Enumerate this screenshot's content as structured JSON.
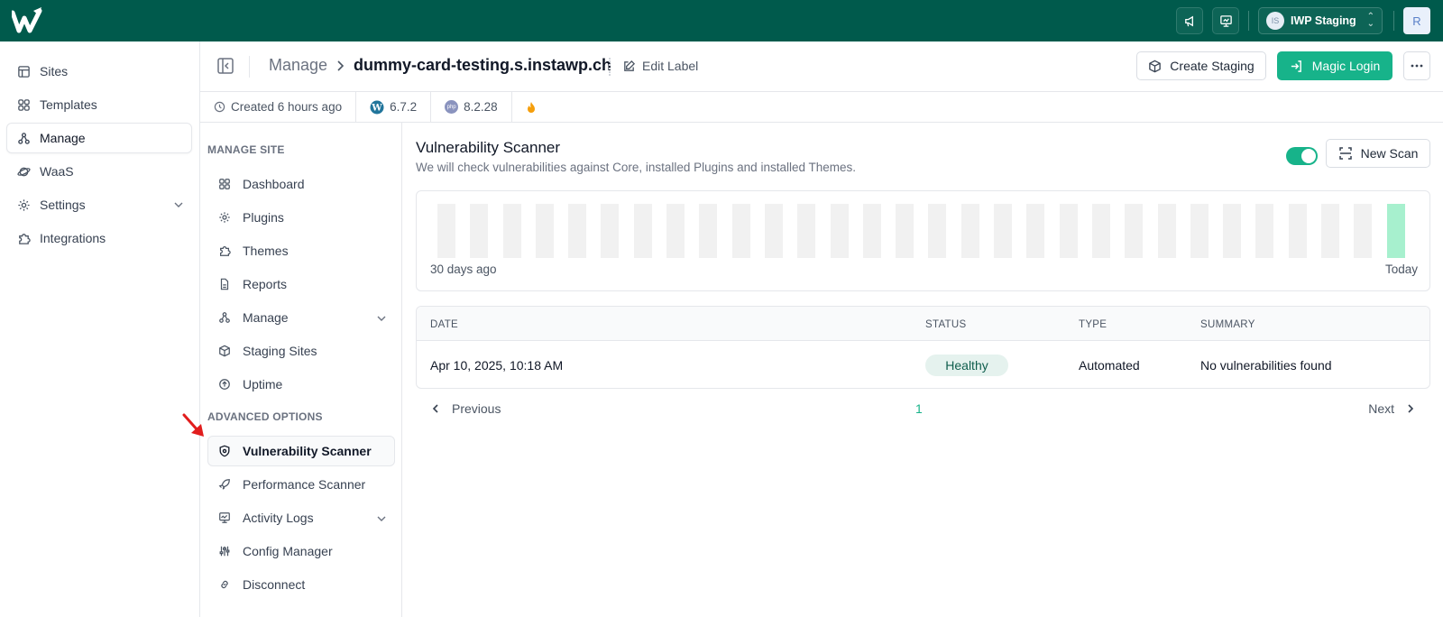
{
  "colors": {
    "brand": "#005a4c",
    "accent": "#17b38a",
    "today_bar": "#a7f0ce"
  },
  "topbar": {
    "team_avatar": "IS",
    "team_name": "IWP Staging",
    "user_initial": "R"
  },
  "sidebar": {
    "items": [
      {
        "label": "Sites",
        "icon": "layout-icon"
      },
      {
        "label": "Templates",
        "icon": "grid-icon"
      },
      {
        "label": "Manage",
        "icon": "nodes-icon"
      },
      {
        "label": "WaaS",
        "icon": "planet-icon"
      },
      {
        "label": "Settings",
        "icon": "gear-icon"
      },
      {
        "label": "Integrations",
        "icon": "puzzle-icon"
      }
    ]
  },
  "header": {
    "crumb_root": "Manage",
    "crumb_site": "dummy-card-testing.s.instawp.ch",
    "edit_label": "Edit Label",
    "create_staging": "Create Staging",
    "magic_login": "Magic Login"
  },
  "info": {
    "created": "Created 6 hours ago",
    "wp_version": "6.7.2",
    "php_badge": "php",
    "php_version": "8.2.28"
  },
  "subnav": {
    "manage_heading": "MANAGE SITE",
    "advanced_heading": "ADVANCED OPTIONS",
    "items": [
      {
        "label": "Dashboard"
      },
      {
        "label": "Plugins"
      },
      {
        "label": "Themes"
      },
      {
        "label": "Reports"
      },
      {
        "label": "Manage"
      },
      {
        "label": "Staging Sites"
      },
      {
        "label": "Uptime"
      },
      {
        "label": "Vulnerability Scanner"
      },
      {
        "label": "Performance Scanner"
      },
      {
        "label": "Activity Logs"
      },
      {
        "label": "Config Manager"
      },
      {
        "label": "Disconnect"
      }
    ]
  },
  "scanner": {
    "title": "Vulnerability Scanner",
    "subtitle": "We will check vulnerabilities against Core, installed Plugins and installed Themes.",
    "toggle_on": true,
    "new_scan": "New Scan",
    "bars_left_label": "30 days ago",
    "bars_right_label": "Today",
    "bars_count": 30
  },
  "table": {
    "columns": [
      "DATE",
      "STATUS",
      "TYPE",
      "SUMMARY"
    ],
    "rows": [
      {
        "date": "Apr 10, 2025, 10:18 AM",
        "status": "Healthy",
        "type": "Automated",
        "summary": "No vulnerabilities found"
      }
    ]
  },
  "pager": {
    "prev": "Previous",
    "page": "1",
    "next": "Next"
  }
}
